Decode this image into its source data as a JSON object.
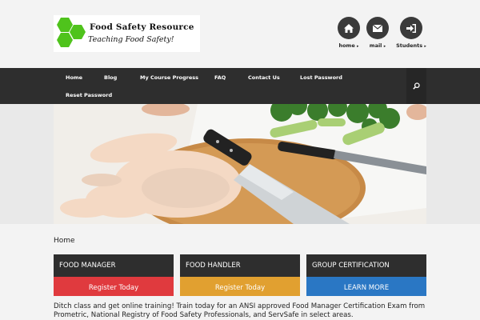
{
  "site": {
    "title": "Food Safety Resource",
    "tagline": "Teaching Food Safety!"
  },
  "header_icons": [
    {
      "label": "home",
      "icon": "home-icon"
    },
    {
      "label": "mail",
      "icon": "mail-icon"
    },
    {
      "label": "Students",
      "icon": "login-icon"
    }
  ],
  "caret": "▸",
  "nav": {
    "items": [
      "Home",
      "Blog",
      "My Course Progress",
      "FAQ",
      "Contact Us",
      "Lost Password",
      "Reset Password"
    ],
    "search_icon": "search-icon"
  },
  "breadcrumb": "Home",
  "cards": [
    {
      "title": "FOOD MANAGER",
      "button": "Register Today",
      "color": "#e03a3e"
    },
    {
      "title": "FOOD HANDLER",
      "button": "Register Today",
      "color": "#e1a030"
    },
    {
      "title": "GROUP CERTIFICATION",
      "button": "LEARN MORE",
      "color": "#2a77c4"
    }
  ],
  "intro": "Ditch class and get online training! Train today for an ANSI approved Food Manager Certification Exam from Prometric, National Registry of Food Safety Professionals, and ServSafe in select areas.",
  "colors": {
    "nav_bg": "#2e2e2e",
    "logo_green": "#4fc31c"
  }
}
